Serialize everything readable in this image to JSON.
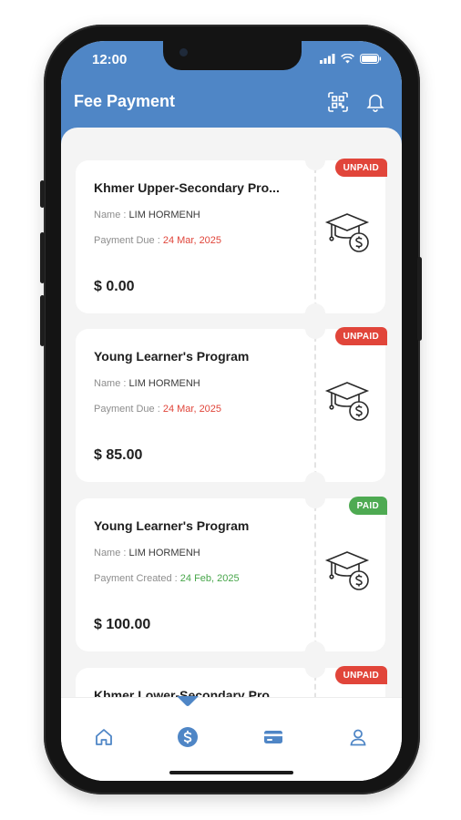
{
  "status_bar": {
    "time": "12:00"
  },
  "header": {
    "title": "Fee Payment",
    "scan_icon": "qr-scan-icon",
    "bell_icon": "bell-icon"
  },
  "colors": {
    "primary": "#4f86c6",
    "unpaid": "#e1453a",
    "paid": "#4eaa52",
    "due_date": "#e0453a",
    "created_date": "#47a64a"
  },
  "cards": [
    {
      "title": "Khmer Upper-Secondary Pro...",
      "name_label": "Name :",
      "name": "LIM HORMENH",
      "date_label": "Payment Due :",
      "date": "24 Mar, 2025",
      "amount": "$ 0.00",
      "status": "UNPAID"
    },
    {
      "title": "Young Learner's Program",
      "name_label": "Name :",
      "name": "LIM HORMENH",
      "date_label": "Payment Due :",
      "date": "24 Mar, 2025",
      "amount": "$ 85.00",
      "status": "UNPAID"
    },
    {
      "title": "Young Learner's Program",
      "name_label": "Name :",
      "name": "LIM HORMENH",
      "date_label": "Payment Created :",
      "date": "24 Feb, 2025",
      "amount": "$ 100.00",
      "status": "PAID"
    },
    {
      "title": "Khmer Lower-Secondary Pro...",
      "status": "UNPAID"
    }
  ],
  "bottom_nav": {
    "items": [
      {
        "icon": "home-icon"
      },
      {
        "icon": "dollar-coin-icon",
        "active": true
      },
      {
        "icon": "card-icon"
      },
      {
        "icon": "profile-icon"
      }
    ]
  }
}
